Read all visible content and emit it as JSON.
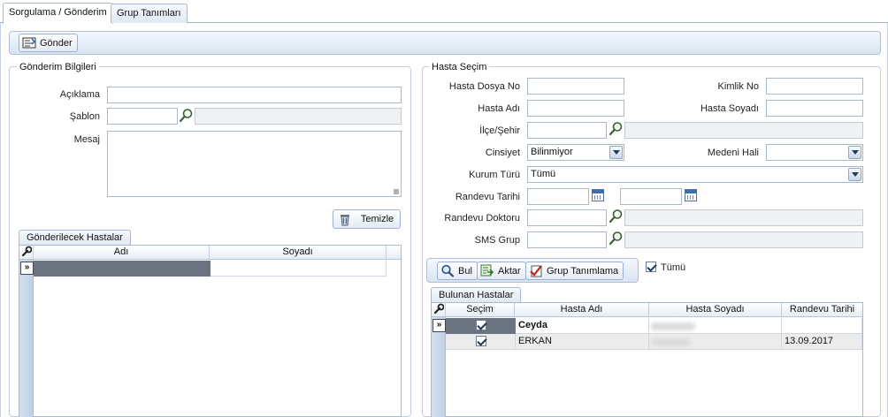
{
  "tabs": [
    "Sorgulama / Gönderim",
    "Grup Tanımları"
  ],
  "toolbar": {
    "send_label": "Gönder"
  },
  "gonderim": {
    "legend": "Gönderim Bilgileri",
    "aciklama_label": "Açıklama",
    "sablon_label": "Şablon",
    "mesaj_label": "Mesaj",
    "temizle_label": "Temizle"
  },
  "gonderilecek": {
    "tab": "Gönderilecek Hastalar",
    "columns": [
      "Adı",
      "Soyadı"
    ]
  },
  "hasta_secim": {
    "legend": "Hasta Seçim",
    "dosya_no_label": "Hasta Dosya No",
    "kimlik_no_label": "Kimlik No",
    "adi_label": "Hasta Adı",
    "soyadi_label": "Hasta Soyadı",
    "ilce_label": "İlçe/Şehir",
    "cinsiyet_label": "Cinsiyet",
    "cinsiyet_value": "Bilinmiyor",
    "medeni_label": "Medeni Hali",
    "medeni_value": "",
    "kurum_label": "Kurum Türü",
    "kurum_value": "Tümü",
    "randevu_tarihi_label": "Randevu Tarihi",
    "randevu_doktoru_label": "Randevu Doktoru",
    "sms_grup_label": "SMS Grup"
  },
  "actions": {
    "bul": "Bul",
    "aktar": "Aktar",
    "grup": "Grup Tanımlama",
    "tumu": "Tümü"
  },
  "bulunan": {
    "tab": "Bulunan Hastalar",
    "columns": [
      "Seçim",
      "Hasta Adı",
      "Hasta Soyadı",
      "Randevu Tarihi"
    ],
    "rows": [
      {
        "secim": true,
        "adi": "Ceyda",
        "soyadi": "",
        "tarih": ""
      },
      {
        "secim": true,
        "adi": "ERKAN",
        "soyadi": "",
        "tarih": "13.09.2017"
      }
    ]
  }
}
